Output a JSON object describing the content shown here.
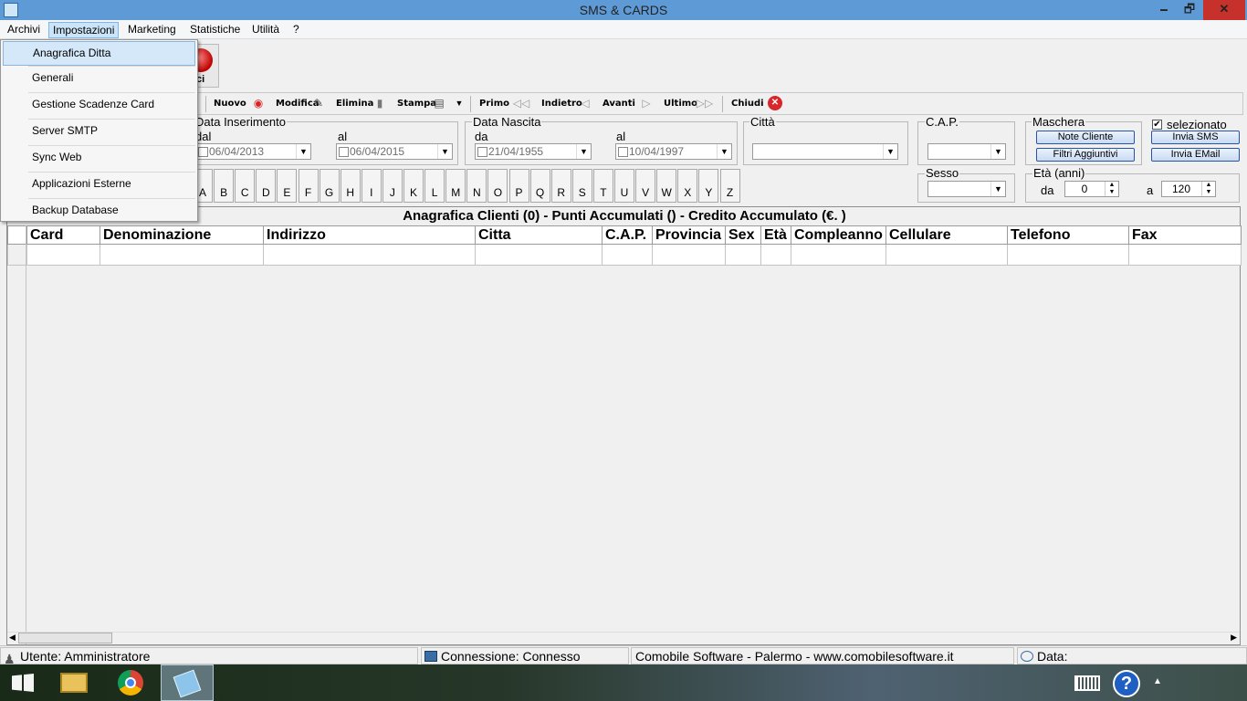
{
  "window": {
    "title": "SMS & CARDS",
    "min": "🗕",
    "max": "🗗",
    "close": "✕"
  },
  "menubar": {
    "items": [
      "Archivi",
      "Impostazioni",
      "Marketing",
      "Statistiche",
      "Utilità",
      "?"
    ]
  },
  "dropdown": {
    "items": [
      "Anagrafica Ditta",
      "Generali",
      "Gestione Scadenze Card",
      "Server SMTP",
      "Sync Web",
      "Applicazioni Esterne",
      "Backup Database"
    ]
  },
  "big_icon": {
    "label": "ci"
  },
  "toolbar": {
    "nuovo": "Nuovo",
    "modifica": "Modifica",
    "elimina": "Elimina",
    "stampa": "Stampa",
    "primo": "Primo",
    "indietro": "Indietro",
    "avanti": "Avanti",
    "ultimo": "Ultimo",
    "chiudi": "Chiudi"
  },
  "filters": {
    "data_inserimento": {
      "label": "Data Inserimento",
      "dal_label": "dal",
      "dal": "06/04/2013",
      "al_label": "al",
      "al": "06/04/2015"
    },
    "data_nascita": {
      "label": "Data Nascita",
      "da_label": "da",
      "da": "21/04/1955",
      "al_label": "al",
      "al": "10/04/1997"
    },
    "citta": {
      "label": "Città",
      "value": ""
    },
    "cap": {
      "label": "C.A.P.",
      "value": ""
    },
    "sesso": {
      "label": "Sesso",
      "value": ""
    },
    "maschera": {
      "label": "Maschera",
      "note_cliente": "Note Cliente",
      "filtri": "Filtri Aggiuntivi"
    },
    "selezionato": {
      "label": "selezionato",
      "checked": true,
      "invia_sms": "Invia SMS",
      "invia_email": "Invia EMail"
    },
    "eta": {
      "label": "Età (anni)",
      "da_label": "da",
      "da": "0",
      "a_label": "a",
      "a": "120"
    }
  },
  "alphabet": [
    "A",
    "B",
    "C",
    "D",
    "E",
    "F",
    "G",
    "H",
    "I",
    "J",
    "K",
    "L",
    "M",
    "N",
    "O",
    "P",
    "Q",
    "R",
    "S",
    "T",
    "U",
    "V",
    "W",
    "X",
    "Y",
    "Z"
  ],
  "grid": {
    "title": "Anagrafica Clienti (0)  - Punti Accumulati () - Credito Accumulato (€. )",
    "columns": [
      "Card",
      "Denominazione",
      "Indirizzo",
      "Citta",
      "C.A.P.",
      "Provincia",
      "Sex",
      "Età",
      "Compleanno",
      "Cellulare",
      "Telefono",
      "Fax"
    ]
  },
  "status": {
    "utente": "Utente: Amministratore",
    "connessione": "Connessione: Connesso",
    "company": "Comobile Software - Palermo - www.comobilesoftware.it",
    "data": "Data:"
  },
  "colors": {
    "titlebar": "#5e9bd6",
    "close": "#c7312b",
    "menu_highlight": "#d5e8f9"
  }
}
